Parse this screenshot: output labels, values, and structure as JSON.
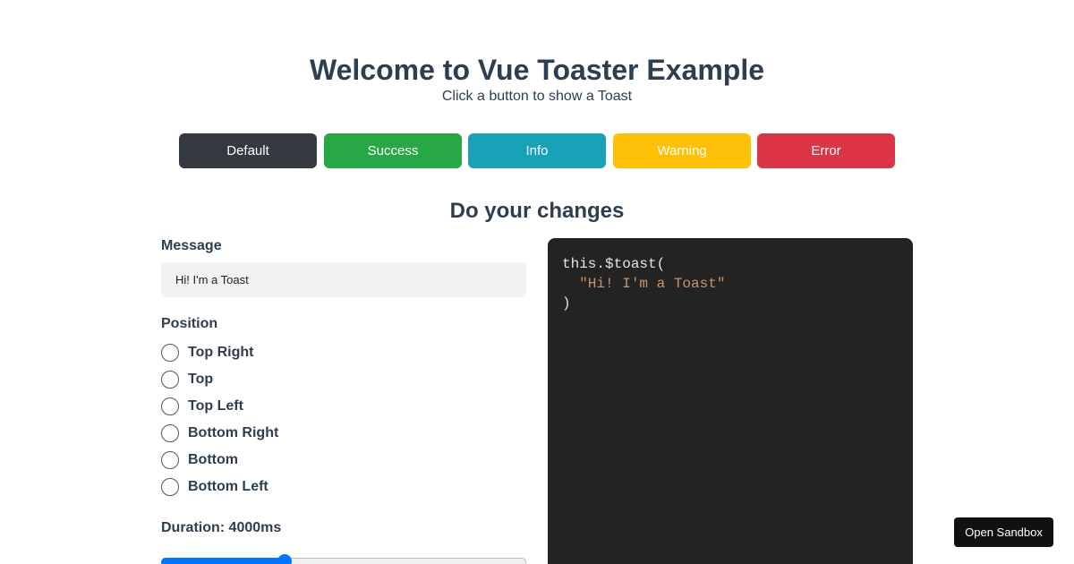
{
  "header": {
    "title": "Welcome to Vue Toaster Example",
    "subtitle": "Click a button to show a Toast"
  },
  "toast_buttons": [
    {
      "label": "Default",
      "color": "#343a40"
    },
    {
      "label": "Success",
      "color": "#28a745"
    },
    {
      "label": "Info",
      "color": "#17a2b8"
    },
    {
      "label": "Warning",
      "color": "#ffc107"
    },
    {
      "label": "Error",
      "color": "#dc3545"
    }
  ],
  "section": {
    "title": "Do your changes"
  },
  "form": {
    "message_label": "Message",
    "message_value": "Hi! I'm a Toast",
    "position_label": "Position",
    "positions": [
      {
        "label": "Top Right",
        "selected": false
      },
      {
        "label": "Top",
        "selected": false
      },
      {
        "label": "Top Left",
        "selected": false
      },
      {
        "label": "Bottom Right",
        "selected": false
      },
      {
        "label": "Bottom",
        "selected": false
      },
      {
        "label": "Bottom Left",
        "selected": false
      }
    ],
    "duration_label": "Duration: 4000ms",
    "duration_fraction": 0.34
  },
  "code": {
    "line1": "this.$toast(",
    "line2": "  \"Hi! I'm a Toast\"",
    "line3": ")"
  },
  "sandbox": {
    "label": "Open Sandbox"
  },
  "colors": {
    "text": "#2c3e50",
    "code_background": "#232323",
    "code_string": "#c9946a",
    "slider_accent": "#0075ff"
  }
}
